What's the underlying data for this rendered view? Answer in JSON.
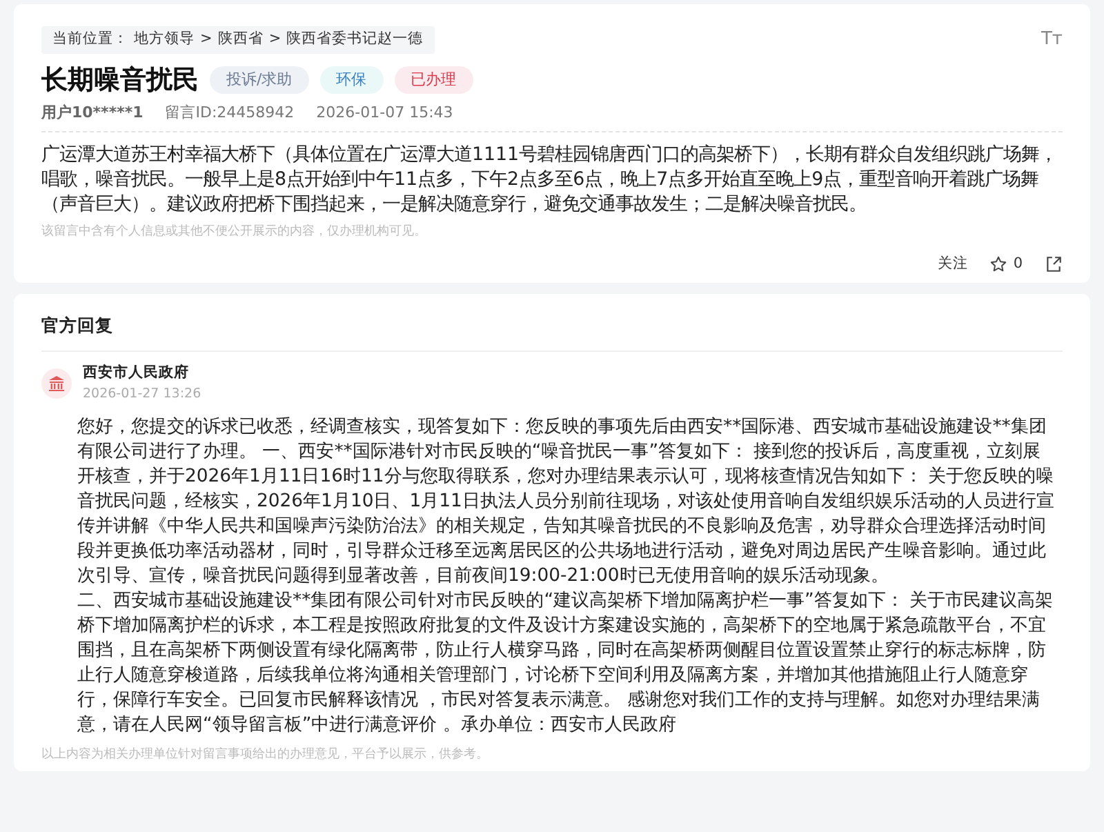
{
  "breadcrumb": {
    "label": "当前位置：",
    "items": [
      {
        "text": "地方领导"
      },
      {
        "text": "陕西省"
      },
      {
        "text": "陕西省委书记赵一德"
      }
    ],
    "separator": ">"
  },
  "font_size_toggle": "Tт",
  "message": {
    "title": "长期噪音扰民",
    "tags": [
      {
        "text": "投诉/求助",
        "kind": "type"
      },
      {
        "text": "环保",
        "kind": "field"
      },
      {
        "text": "已办理",
        "kind": "status"
      }
    ],
    "user": "用户10*****1",
    "id": "留言ID:24458942",
    "time": "2026-01-07 15:43",
    "body": "广运潭大道苏王村幸福大桥下（具体位置在广运潭大道1111号碧桂园锦唐西门口的高架桥下），长期有群众自发组织跳广场舞，唱歌，噪音扰民。一般早上是8点开始到中午11点多，下午2点多至6点，晚上7点多开始直至晚上9点，重型音响开着跳广场舞（声音巨大）。建议政府把桥下围挡起来，一是解决随意穿行，避免交通事故发生；二是解决噪音扰民。",
    "privacy_note": "该留言中含有个人信息或其他不便公开展示的内容，仅办理机构可见。",
    "follow_label": "关注",
    "like_count": "0"
  },
  "reply": {
    "heading": "官方回复",
    "org": "西安市人民政府",
    "time": "2026-01-27 13:26",
    "paragraphs": [
      "您好，您提交的诉求已收悉，经调查核实，现答复如下：您反映的事项先后由西安**国际港、西安城市基础设施建设**集团有限公司进行了办理。 一、西安**国际港针对市民反映的“噪音扰民一事”答复如下： 接到您的投诉后，高度重视，立刻展开核查，并于2026年1月11日16时11分与您取得联系，您对办理结果表示认可，现将核查情况告知如下： 关于您反映的噪音扰民问题，经核实，2026年1月10日、1月11日执法人员分别前往现场，对该处使用音响自发组织娱乐活动的人员进行宣传并讲解《中华人民共和国噪声污染防治法》的相关规定，告知其噪音扰民的不良影响及危害，劝导群众合理选择活动时间段并更换低功率活动器材，同时，引导群众迁移至远离居民区的公共场地进行活动，避免对周边居民产生噪音影响。通过此次引导、宣传，噪音扰民问题得到显著改善，目前夜间19:00-21:00时已无使用音响的娱乐活动现象。",
      "二、西安城市基础设施建设**集团有限公司针对市民反映的“建议高架桥下增加隔离护栏一事”答复如下： 关于市民建议高架桥下增加隔离护栏的诉求，本工程是按照政府批复的文件及设计方案建设实施的，高架桥下的空地属于紧急疏散平台，不宜围挡，且在高架桥下两侧设置有绿化隔离带，防止行人横穿马路，同时在高架桥两侧醒目位置设置禁止穿行的标志标牌，防止行人随意穿梭道路，后续我单位将沟通相关管理部门，讨论桥下空间利用及隔离方案，并增加其他措施阻止行人随意穿行，保障行车安全。已回复市民解释该情况 ，市民对答复表示满意。 感谢您对我们工作的支持与理解。如您对办理结果满意，请在人民网“领导留言板”中进行满意评价 。承办单位：西安市人民政府"
    ],
    "footer_note": "以上内容为相关办理单位针对留言事项给出的办理意见，平台予以展示，供参考。"
  }
}
